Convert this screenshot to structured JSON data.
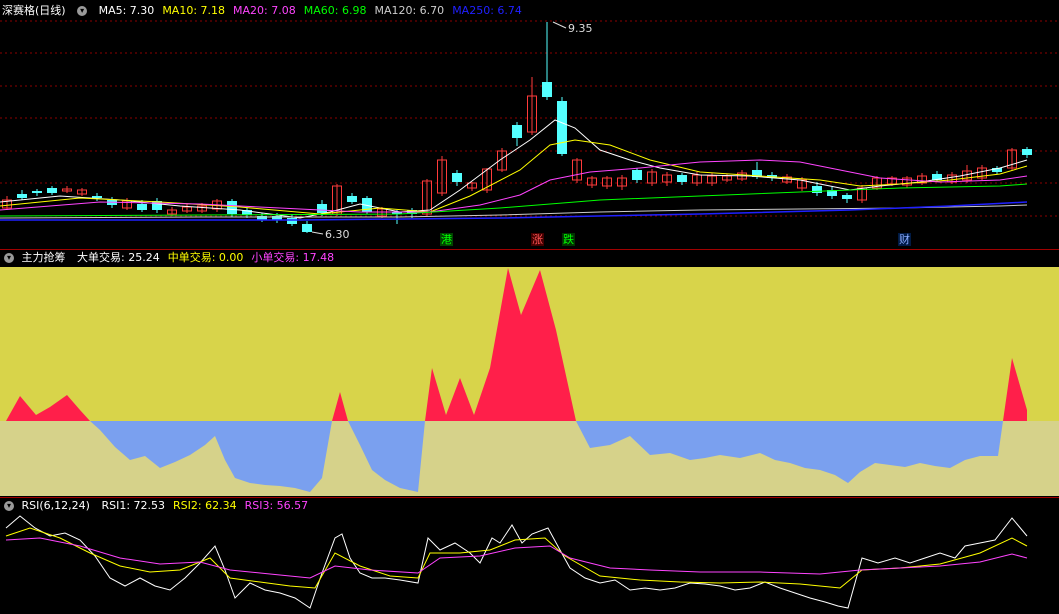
{
  "main_panel": {
    "title": "深赛格(日线)",
    "ma": [
      {
        "label": "MA5: 7.30",
        "color": "#ffffff"
      },
      {
        "label": "MA10: 7.18",
        "color": "#ffff00"
      },
      {
        "label": "MA20: 7.08",
        "color": "#ff44ff"
      },
      {
        "label": "MA60: 6.98",
        "color": "#00ff00"
      },
      {
        "label": "MA120: 6.70",
        "color": "#cccccc"
      },
      {
        "label": "MA250: 6.74",
        "color": "#2020ff"
      }
    ],
    "high_label": "9.35",
    "low_label": "6.30",
    "event_tags": [
      {
        "text": "港",
        "color": "#00ff00",
        "bg": "#004400"
      },
      {
        "text": "涨",
        "color": "#ff5555",
        "bg": "#440000"
      },
      {
        "text": "跌",
        "color": "#00ff00",
        "bg": "#003300"
      },
      {
        "text": "财",
        "color": "#88aaff",
        "bg": "#001a44"
      }
    ]
  },
  "flow_panel": {
    "title": "主力抢筹",
    "items": [
      {
        "label": "大单交易: 25.24",
        "color": "#ffffff"
      },
      {
        "label": "中单交易: 0.00",
        "color": "#ffff00"
      },
      {
        "label": "小单交易: 17.48",
        "color": "#ff44ff"
      }
    ]
  },
  "rsi_panel": {
    "title": "RSI(6,12,24)",
    "items": [
      {
        "label": "RSI1: 72.53",
        "color": "#ffffff"
      },
      {
        "label": "RSI2: 62.34",
        "color": "#ffff00"
      },
      {
        "label": "RSI3: 56.57",
        "color": "#ff44ff"
      }
    ]
  },
  "colors": {
    "up": "#ff3b3b",
    "down": "#54ffff",
    "flow_pos": "#ff1f4a",
    "flow_neg": "#7aa0ef",
    "flow_bg_top": "#d8d44a",
    "flow_bg_bottom": "#d6d28a",
    "grid": "#8b0000"
  }
}
